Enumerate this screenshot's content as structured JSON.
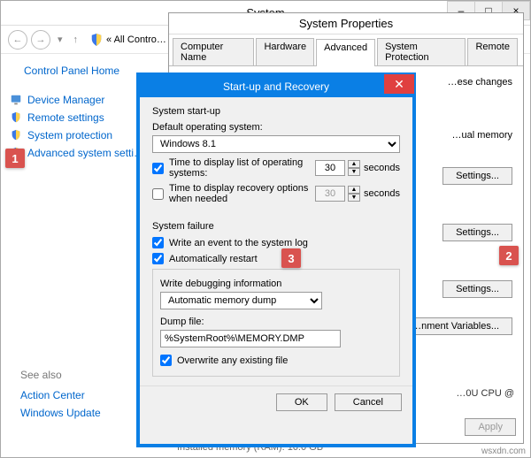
{
  "system_window": {
    "title": "System",
    "breadcrumb_text": "« All Contro…",
    "sidebar": {
      "home": "Control Panel Home",
      "items": [
        {
          "label": "Device Manager"
        },
        {
          "label": "Remote settings"
        },
        {
          "label": "System protection"
        },
        {
          "label": "Advanced system setti…"
        }
      ],
      "see_also": {
        "header": "See also",
        "items": [
          "Action Center",
          "Windows Update"
        ]
      }
    }
  },
  "system_properties": {
    "title": "System Properties",
    "tabs": [
      "Computer Name",
      "Hardware",
      "Advanced",
      "System Protection",
      "Remote"
    ],
    "active_tab": "Advanced",
    "advanced": {
      "top_text": "…ese changes",
      "ual_memory": "…ual memory",
      "settings_button": "Settings...",
      "env_button": "…nment Variables...",
      "apply": "Apply"
    },
    "cpu_text": "…0U CPU @",
    "mem_text": "Installed memory (RAM):    16.0 GB"
  },
  "startup_recovery": {
    "title": "Start-up and Recovery",
    "startup": {
      "group": "System start-up",
      "default_os_label": "Default operating system:",
      "default_os": "Windows 8.1",
      "time_list_label": "Time to display list of operating systems:",
      "time_list_value": "30",
      "time_recovery_label": "Time to display recovery options when needed",
      "time_recovery_value": "30",
      "seconds": "seconds"
    },
    "failure": {
      "group": "System failure",
      "write_event": "Write an event to the system log",
      "auto_restart": "Automatically restart",
      "debug_label": "Write debugging information",
      "debug_option": "Automatic memory dump",
      "dump_label": "Dump file:",
      "dump_value": "%SystemRoot%\\MEMORY.DMP",
      "overwrite": "Overwrite any existing file"
    },
    "ok": "OK",
    "cancel": "Cancel"
  },
  "callouts": {
    "c1": "1",
    "c2": "2",
    "c3": "3"
  },
  "watermark": "wsxdn.com"
}
